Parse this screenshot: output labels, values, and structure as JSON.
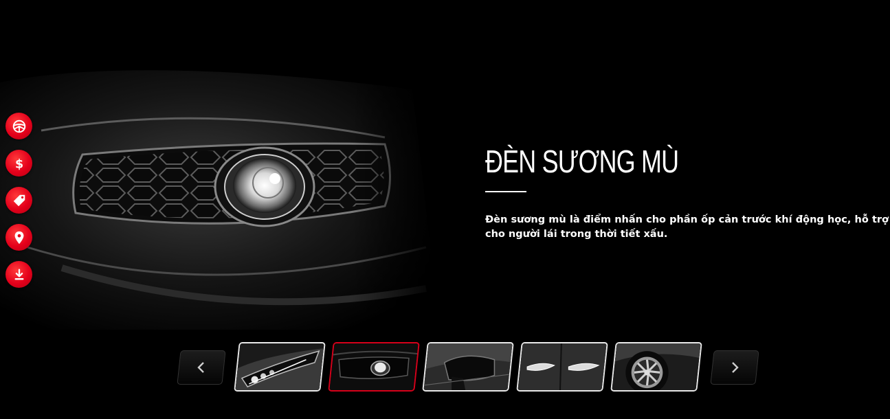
{
  "feature": {
    "title": "ĐÈN SƯƠNG MÙ",
    "description": "Đèn sương mù là điểm nhấn cho phần ốp cản trước khí động học, hỗ trợ cho người lái trong thời tiết xấu."
  },
  "side_actions": [
    {
      "icon": "steering-wheel-icon"
    },
    {
      "icon": "dollar-icon"
    },
    {
      "icon": "price-tag-icon"
    },
    {
      "icon": "location-pin-icon"
    },
    {
      "icon": "download-icon"
    }
  ],
  "carousel": {
    "thumbnails": [
      {
        "subject": "headlight",
        "active": false
      },
      {
        "subject": "fog-light",
        "active": true
      },
      {
        "subject": "side-mirror",
        "active": false
      },
      {
        "subject": "chrome-door-handles",
        "active": false
      },
      {
        "subject": "alloy-wheel",
        "active": false
      }
    ],
    "prev_icon": "chevron-left-icon",
    "next_icon": "chevron-right-icon"
  },
  "colors": {
    "accent": "#e4001b",
    "background": "#000000",
    "text": "#ffffff"
  }
}
